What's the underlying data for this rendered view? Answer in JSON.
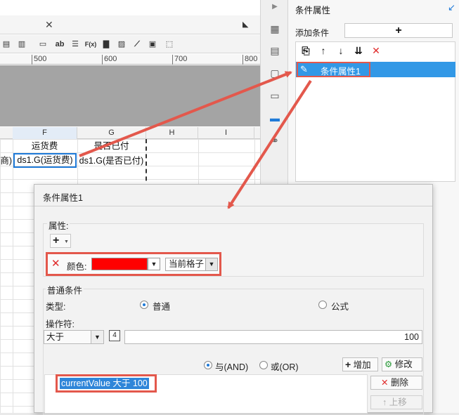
{
  "designer": {
    "ruler_marks": [
      "500",
      "600",
      "700",
      "800"
    ],
    "columns": [
      "F",
      "G",
      "H",
      "I"
    ],
    "cells": {
      "f1": "运货费",
      "g1": "是否已付",
      "e2": "商)",
      "f2": "ds1.G(运货费)",
      "g2": "ds1.G(是否已付)"
    },
    "toolbar_glyphs": {
      "text": "ab",
      "formula": "F(x)"
    }
  },
  "right_panel": {
    "title": "条件属性",
    "add_condition_label": "添加条件",
    "add_button": "+",
    "selected_item": "条件属性1"
  },
  "dialog": {
    "title": "条件属性1",
    "attributes_label": "属性:",
    "attr_plus": "+",
    "attr_color_label": "颜色:",
    "attr_color_value": "#ff0000",
    "attr_scope": "当前格子",
    "general_condition_label": "普通条件",
    "type_label": "类型:",
    "type_options": [
      "普通",
      "公式"
    ],
    "operator_label": "操作符:",
    "operator_value": "大于",
    "operand_value": "100",
    "logic_options": [
      "与(AND)",
      "或(OR)"
    ],
    "add_button": "增加",
    "modify_button": "修改",
    "delete_button": "删除",
    "move_up_button": "上移",
    "condition_item": "currentValue 大于 100"
  },
  "colors": {
    "accent_blue": "#1f7ad8",
    "selection_blue": "#3298e6",
    "highlight_red": "#e3584c"
  }
}
